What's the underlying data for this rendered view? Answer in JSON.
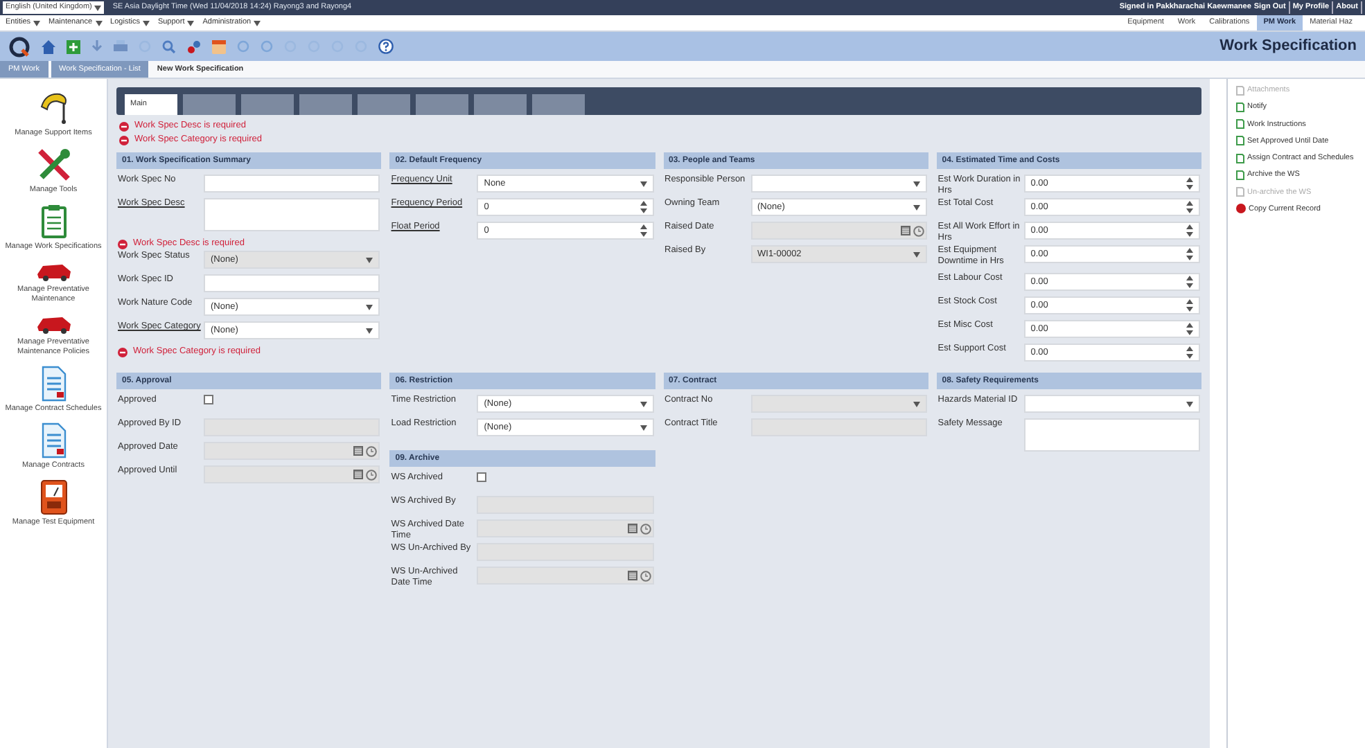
{
  "top_bar": {
    "language": "English (United Kingdom)",
    "timezone": "SE Asia Daylight Time (Wed 11/04/2018 14:24) Rayong3 and Rayong4",
    "signed_in": "Signed in Pakkharachai Kaewmanee",
    "links": [
      "Sign Out",
      "My Profile",
      "About"
    ]
  },
  "menu": [
    "Entities",
    "Maintenance",
    "Logistics",
    "Support",
    "Administration"
  ],
  "module_tabs": [
    {
      "label": "Equipment",
      "selected": false
    },
    {
      "label": "Work",
      "selected": false
    },
    {
      "label": "Calibrations",
      "selected": false
    },
    {
      "label": "PM Work",
      "selected": true
    },
    {
      "label": "Material Haz",
      "selected": false
    }
  ],
  "page_title": "Work Specification",
  "breadcrumb": [
    "PM Work",
    "Work Specification - List",
    "New Work Specification"
  ],
  "sidebar": [
    {
      "label": "Manage Support Items",
      "kind": "brush"
    },
    {
      "label": "Manage Tools",
      "kind": "tools"
    },
    {
      "label": "Manage Work Specifications",
      "kind": "clipboard"
    },
    {
      "label": "Manage Preventative Maintenance",
      "kind": "car"
    },
    {
      "label": "Manage Preventative Maintenance Policies",
      "kind": "car"
    },
    {
      "label": "Manage Contract Schedules",
      "kind": "document"
    },
    {
      "label": "Manage Contracts",
      "kind": "document"
    },
    {
      "label": "Manage Test Equipment",
      "kind": "meter"
    }
  ],
  "form_tabs": [
    {
      "label": "Main",
      "selected": true
    },
    {
      "selected": false
    },
    {
      "selected": false
    },
    {
      "selected": false
    },
    {
      "selected": false
    },
    {
      "selected": false
    },
    {
      "selected": false
    },
    {
      "selected": false
    }
  ],
  "errors": [
    "Work Spec Desc is required",
    "Work Spec Category is required"
  ],
  "rows": [
    {
      "columns": [
        {
          "sections": [
            {
              "title": "01. Work Specification Summary",
              "fields": [
                {
                  "label": "Work Spec No",
                  "kind": "text",
                  "link": false,
                  "disabled": false
                },
                {
                  "label": "Work Spec Desc",
                  "kind": "textarea",
                  "link": true,
                  "disabled": false
                },
                {
                  "label": "Work Spec Desc is required",
                  "kind": "error"
                },
                {
                  "label": "Work Spec Status",
                  "kind": "select",
                  "value": "(None)",
                  "link": false,
                  "disabled": true
                },
                {
                  "label": "Work Spec ID",
                  "kind": "text",
                  "link": false,
                  "disabled": false
                },
                {
                  "label": "Work Nature Code",
                  "kind": "select",
                  "value": "(None)",
                  "link": false,
                  "disabled": false
                },
                {
                  "label": "Work Spec Category",
                  "kind": "select",
                  "value": "(None)",
                  "link": true,
                  "disabled": false
                },
                {
                  "label": "Work Spec Category is required",
                  "kind": "error"
                }
              ]
            }
          ]
        },
        {
          "sections": [
            {
              "title": "02. Default Frequency",
              "fields": [
                {
                  "label": "Frequency Unit",
                  "kind": "select",
                  "value": "None",
                  "link": true,
                  "disabled": false
                },
                {
                  "label": "Frequency Period",
                  "kind": "spinner",
                  "value": "0",
                  "link": true,
                  "disabled": false
                },
                {
                  "label": "Float Period",
                  "kind": "spinner",
                  "value": "0",
                  "link": true,
                  "disabled": false
                }
              ]
            }
          ]
        },
        {
          "sections": [
            {
              "title": "03. People and Teams",
              "fields": [
                {
                  "label": "Responsible Person",
                  "kind": "select",
                  "link": false,
                  "disabled": false
                },
                {
                  "label": "Owning Team",
                  "kind": "select",
                  "value": "(None)",
                  "link": false,
                  "disabled": false
                },
                {
                  "label": "Raised Date",
                  "kind": "date",
                  "link": false,
                  "disabled": true
                },
                {
                  "label": "Raised By",
                  "kind": "select",
                  "value": "WI1-00002",
                  "link": false,
                  "disabled": true
                }
              ]
            }
          ]
        },
        {
          "sections": [
            {
              "title": "04. Estimated Time and Costs",
              "fields": [
                {
                  "label": "Est Work Duration in Hrs",
                  "kind": "spinner",
                  "value": "0.00",
                  "link": false,
                  "disabled": false
                },
                {
                  "label": "Est Total Cost",
                  "kind": "spinner",
                  "value": "0.00",
                  "link": false,
                  "disabled": false
                },
                {
                  "label": "Est All Work Effort in Hrs",
                  "kind": "spinner",
                  "value": "0.00",
                  "link": false,
                  "disabled": false
                },
                {
                  "label": "Est Equipment Downtime in Hrs",
                  "kind": "spinner",
                  "value": "0.00",
                  "link": false,
                  "disabled": false
                },
                {
                  "label": "Est Labour Cost",
                  "kind": "spinner",
                  "value": "0.00",
                  "link": false,
                  "disabled": false
                },
                {
                  "label": "Est Stock Cost",
                  "kind": "spinner",
                  "value": "0.00",
                  "link": false,
                  "disabled": false
                },
                {
                  "label": "Est Misc Cost",
                  "kind": "spinner",
                  "value": "0.00",
                  "link": false,
                  "disabled": false
                },
                {
                  "label": "Est Support Cost",
                  "kind": "spinner",
                  "value": "0.00",
                  "link": false,
                  "disabled": false
                }
              ]
            }
          ]
        }
      ]
    },
    {
      "columns": [
        {
          "sections": [
            {
              "title": "05. Approval",
              "fields": [
                {
                  "label": "Approved",
                  "kind": "checkbox",
                  "checked": false
                },
                {
                  "label": "Approved By ID",
                  "kind": "text",
                  "link": false,
                  "disabled": true
                },
                {
                  "label": "Approved Date",
                  "kind": "date",
                  "link": false,
                  "disabled": true
                },
                {
                  "label": "Approved Until",
                  "kind": "date",
                  "link": false,
                  "disabled": true
                }
              ]
            }
          ]
        },
        {
          "sections": [
            {
              "title": "06. Restriction",
              "fields": [
                {
                  "label": "Time Restriction",
                  "kind": "select",
                  "value": "(None)",
                  "link": false,
                  "disabled": false
                },
                {
                  "label": "Load Restriction",
                  "kind": "select",
                  "value": "(None)",
                  "link": false,
                  "disabled": false
                }
              ]
            },
            {
              "title": "09. Archive",
              "fields": [
                {
                  "label": "WS Archived",
                  "kind": "checkbox",
                  "checked": false
                },
                {
                  "label": "WS Archived By",
                  "kind": "text",
                  "link": false,
                  "disabled": true
                },
                {
                  "label": "WS Archived Date Time",
                  "kind": "date",
                  "link": false,
                  "disabled": true
                },
                {
                  "label": "WS Un-Archived By",
                  "kind": "text",
                  "link": false,
                  "disabled": true
                },
                {
                  "label": "WS Un-Archived Date Time",
                  "kind": "date",
                  "link": false,
                  "disabled": true
                }
              ]
            }
          ]
        },
        {
          "sections": [
            {
              "title": "07. Contract",
              "fields": [
                {
                  "label": "Contract No",
                  "kind": "select",
                  "link": false,
                  "disabled": true
                },
                {
                  "label": "Contract Title",
                  "kind": "text",
                  "link": false,
                  "disabled": true
                }
              ]
            }
          ]
        },
        {
          "sections": [
            {
              "title": "08. Safety Requirements",
              "fields": [
                {
                  "label": "Hazards Material ID",
                  "kind": "select",
                  "link": false,
                  "disabled": false
                },
                {
                  "label": "Safety Message",
                  "kind": "textarea",
                  "link": false,
                  "disabled": false
                }
              ]
            }
          ]
        }
      ]
    }
  ],
  "actions": [
    {
      "label": "Attachments",
      "disabled": true,
      "kind": "doc"
    },
    {
      "label": "Notify",
      "disabled": false,
      "kind": "doc"
    },
    {
      "label": "Work Instructions",
      "disabled": false,
      "kind": "doc"
    },
    {
      "label": "Set Approved Until Date",
      "disabled": false,
      "kind": "doc"
    },
    {
      "label": "Assign Contract and Schedules",
      "disabled": false,
      "kind": "doc"
    },
    {
      "label": "Archive the WS",
      "disabled": false,
      "kind": "doc"
    },
    {
      "label": "Un-archive the WS",
      "disabled": true,
      "kind": "doc"
    },
    {
      "label": "Copy Current Record",
      "disabled": false,
      "kind": "dot"
    }
  ]
}
